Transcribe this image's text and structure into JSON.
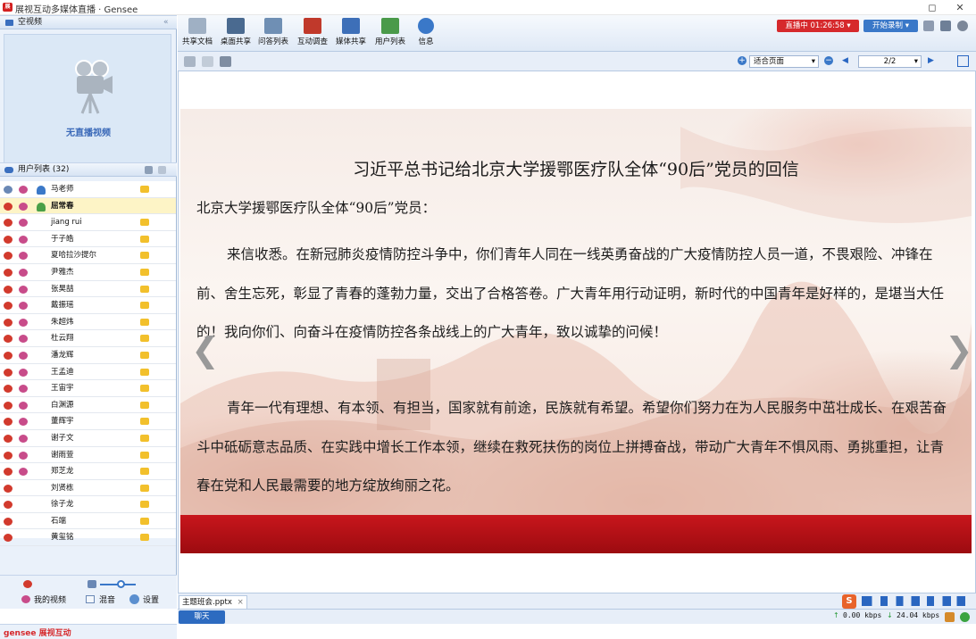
{
  "window": {
    "title": "展视互动多媒体直播 · Gensee"
  },
  "left": {
    "video_header": "空视频",
    "no_video": "无直播视频",
    "userlist_header": "用户列表 (32)",
    "users": [
      {
        "name": "马老师",
        "role": "host"
      },
      {
        "name": "屈常春",
        "role": "me",
        "selected": true
      },
      {
        "name": "jiang rui"
      },
      {
        "name": "于子皓"
      },
      {
        "name": "夏哈拉沙提尔"
      },
      {
        "name": "尹雅杰"
      },
      {
        "name": "张昊喆"
      },
      {
        "name": "戴振瑶"
      },
      {
        "name": "朱超炜"
      },
      {
        "name": "杜云翔"
      },
      {
        "name": "潘龙辉"
      },
      {
        "name": "王孟迪"
      },
      {
        "name": "王宙宇"
      },
      {
        "name": "白渊源"
      },
      {
        "name": "董辉宇"
      },
      {
        "name": "谢子文"
      },
      {
        "name": "谢雨萱"
      },
      {
        "name": "郑芝龙"
      },
      {
        "name": "刘贤栋"
      },
      {
        "name": "徐子龙"
      },
      {
        "name": "石端"
      },
      {
        "name": "黄玺铭"
      }
    ],
    "my_video": "我的视频",
    "mix": "混音",
    "settings": "设置",
    "brand": "gensee 展视互动"
  },
  "toolbar": {
    "items": [
      "共享文档",
      "桌面共享",
      "问答列表",
      "互动调查",
      "媒体共享",
      "用户列表",
      "信息"
    ],
    "live_label": "直播中  01:26:58",
    "record_label": "开始录制"
  },
  "docnav": {
    "fit": "适合页面",
    "page": "2/2"
  },
  "slide": {
    "title": "习近平总书记给北京大学援鄂医疗队全体“90后”党员的回信",
    "greeting": "北京大学援鄂医疗队全体“90后”党员：",
    "p1": "来信收悉。在新冠肺炎疫情防控斗争中，你们青年人同在一线英勇奋战的广大疫情防控人员一道，不畏艰险、冲锋在前、舍生忘死，彰显了青春的蓬勃力量，交出了合格答卷。广大青年用行动证明，新时代的中国青年是好样的，是堪当大任的！我向你们、向奋斗在疫情防控各条战线上的广大青年，致以诚挚的问候！",
    "p2": "青年一代有理想、有本领、有担当，国家就有前途，民族就有希望。希望你们努力在为人民服务中茁壮成长、在艰苦奋斗中砥砺意志品质、在实践中增长工作本领，继续在救死扶伤的岗位上拼搏奋战，带动广大青年不惧风雨、勇挑重担，让青春在党和人民最需要的地方绽放绚丽之花。"
  },
  "bottom": {
    "doc_tab": "主题班会.pptx",
    "chat": "聊天",
    "up": "0.00 kbps",
    "down": "24.04 kbps"
  },
  "colors": {
    "accent": "#2d6bc0",
    "live": "#d6292c",
    "panel": "#eaf1fa"
  }
}
